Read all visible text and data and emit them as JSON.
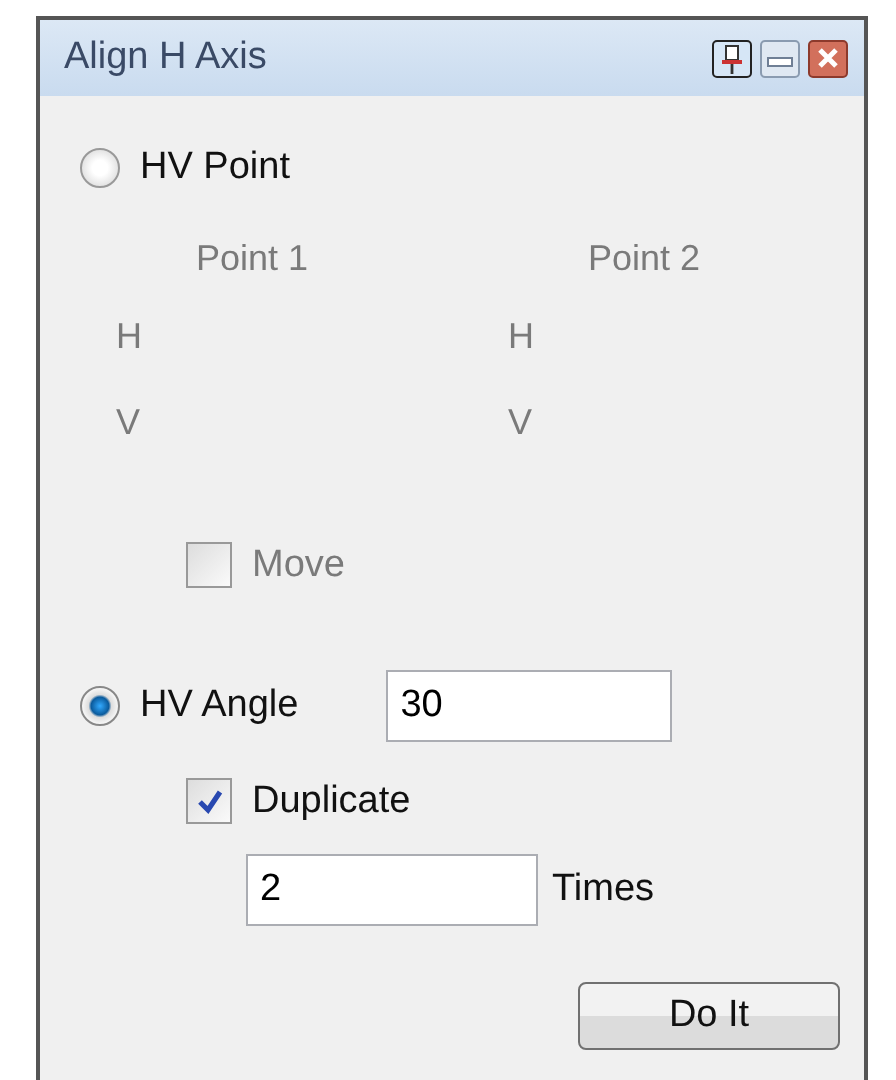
{
  "window": {
    "title": "Align H Axis"
  },
  "point_mode": {
    "label": "HV Point",
    "selected": false,
    "disabled": true,
    "columns": [
      {
        "heading": "Point 1",
        "h_label": "H",
        "v_label": "V"
      },
      {
        "heading": "Point 2",
        "h_label": "H",
        "v_label": "V"
      }
    ],
    "move": {
      "label": "Move",
      "checked": false
    }
  },
  "angle_mode": {
    "label": "HV Angle",
    "selected": true,
    "value": "30",
    "duplicate": {
      "label": "Duplicate",
      "checked": true
    },
    "times": {
      "value": "2",
      "label": "Times"
    }
  },
  "buttons": [
    "Do It"
  ]
}
